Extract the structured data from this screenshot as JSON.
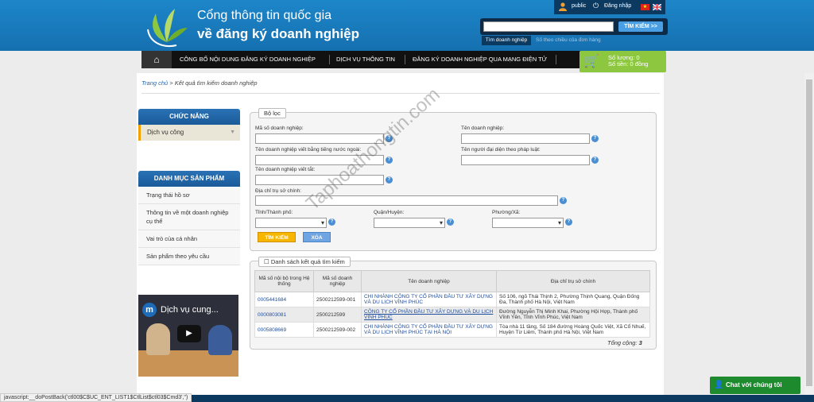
{
  "header": {
    "title_line1": "Cổng thông tin quốc gia",
    "title_line2": "về đăng ký doanh nghiệp",
    "public_label": "public",
    "login_label": "Đăng nhập"
  },
  "search": {
    "button": "TÌM KIẾM >>",
    "tab_active": "Tìm doanh nghiệp",
    "tab_other": "Số theo chiều của đơn hàng"
  },
  "nav": {
    "items": [
      "CÔNG BỐ NỘI DUNG ĐĂNG KÝ DOANH NGHIỆP",
      "DỊCH VỤ THÔNG TIN",
      "ĐĂNG KÝ DOANH NGHIỆP QUA MẠNG ĐIỆN TỬ"
    ]
  },
  "cart": {
    "quantity": "Số lượng: 0",
    "amount": "Số tiền: 0 đồng"
  },
  "breadcrumb": {
    "home": "Trang chủ",
    "separator": " > ",
    "current": "Kết quả tìm kiếm doanh nghiệp"
  },
  "sidebar": {
    "functions_title": "CHỨC NĂNG",
    "functions_active": "Dịch vụ công",
    "catalog_title": "DANH MỤC SẢN PHẨM",
    "catalog_items": [
      "Trạng thái hồ sơ",
      "Thông tin về một doanh nghiệp cụ thể",
      "Vai trò của cá nhân",
      "Sản phẩm theo yêu cầu"
    ],
    "video_title": "Dịch vụ cung..."
  },
  "filter": {
    "legend": "Bộ lọc",
    "label_ma_so": "Mã số doanh nghiệp:",
    "label_ten": "Tên doanh nghiệp:",
    "label_ten_nn": "Tên doanh nghiệp viết bằng tiếng nước ngoài:",
    "label_dai_dien": "Tên người đại diện theo pháp luật:",
    "label_viet_tat": "Tên doanh nghiệp viết tắt:",
    "label_dia_chi": "Địa chỉ trụ sở chính:",
    "label_tinh": "Tỉnh/Thành phố:",
    "label_quan": "Quận/Huyện:",
    "label_phuong": "Phường/Xã:",
    "search_button": "TÌM KIẾM",
    "clear_button": "XÓA"
  },
  "results": {
    "legend": "Danh sách kết quả tìm kiếm",
    "headers": [
      "Mã số nội bộ trong Hệ thống",
      "Mã số doanh nghiệp",
      "Tên doanh nghiệp",
      "Địa chỉ trụ sở chính"
    ],
    "rows": [
      [
        "0005441684",
        "2500212599-001",
        "CHI NHÁNH CÔNG TY CỔ PHẦN ĐẦU TƯ XÂY DỰNG VÀ DU LỊCH VĨNH PHÚC",
        "Số 106, ngõ Thái Thịnh 2, Phường Thịnh Quang, Quận Đống Đa, Thành phố Hà Nội, Việt Nam"
      ],
      [
        "0000803081",
        "2500212599",
        "CÔNG TY CỔ PHẦN ĐẦU TƯ XÂY DỰNG VÀ DU LỊCH VĨNH PHÚC",
        "Đường Nguyễn Thị Minh Khai, Phường Hội Hợp, Thành phố Vĩnh Yên, Tỉnh Vĩnh Phúc, Việt Nam"
      ],
      [
        "0005808669",
        "2500212599-002",
        "CHI NHÁNH CÔNG TY CỔ PHẦN ĐẦU TƯ XÂY DỰNG VÀ DU LỊCH VĨNH PHÚC TẠI HÀ NỘI",
        "Tòa nhà 11 tầng, Số 184 đường Hoàng Quốc Việt, Xã Cổ Nhuế, Huyện Từ Liêm, Thành phố Hà Nội, Việt Nam"
      ]
    ],
    "total_label": "Tổng cộng:",
    "total_value": "3"
  },
  "watermark": "Taphoathongtin.com",
  "chat_label": "Chat với chúng tôi",
  "status_bar": "javascript:__doPostBack('ctl00$C$UC_ENT_LIST1$CtlList$ctl03$Cmd3','')",
  "colors": {
    "header_blue": "#1c86c9",
    "nav_black": "#111111",
    "cart_green": "#8dc63f",
    "search_yellow": "#f7b500",
    "chat_green": "#1d8a2e"
  }
}
